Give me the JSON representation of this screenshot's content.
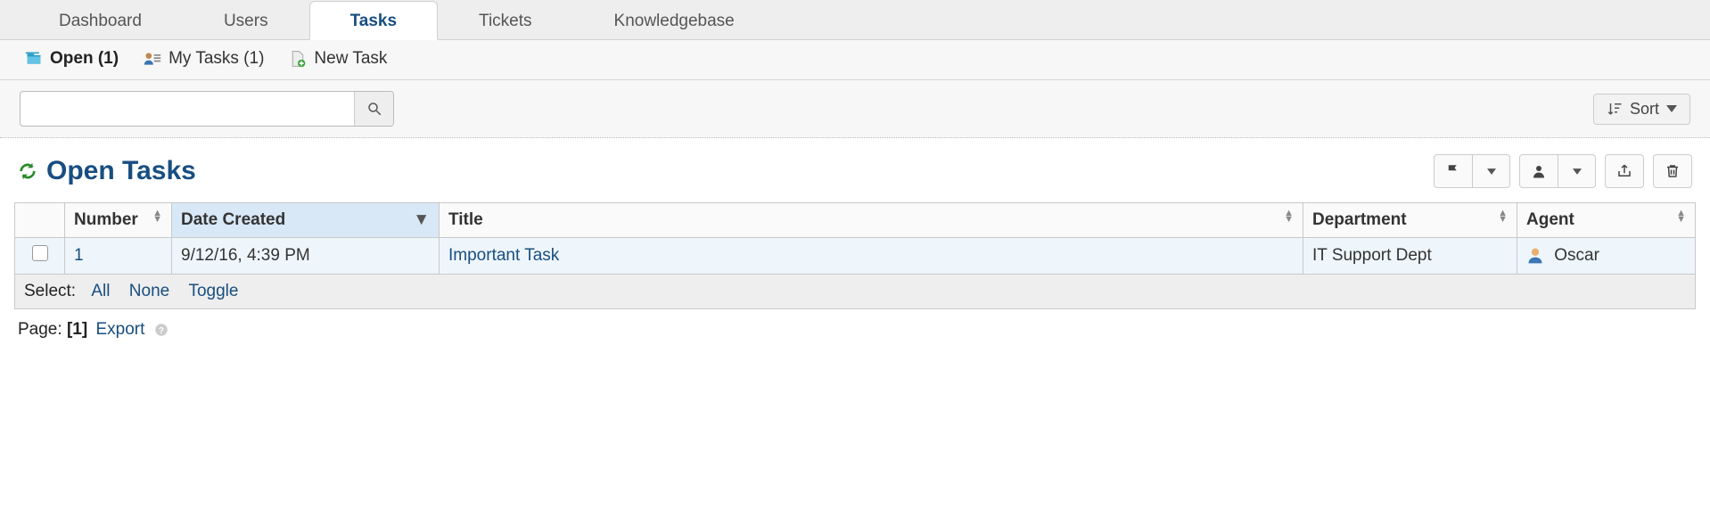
{
  "tabs": {
    "dashboard": "Dashboard",
    "users": "Users",
    "tasks": "Tasks",
    "tickets": "Tickets",
    "kb": "Knowledgebase"
  },
  "subnav": {
    "open": "Open (1)",
    "mytasks": "My Tasks (1)",
    "newtask": "New Task"
  },
  "search": {
    "value": ""
  },
  "sort_label": "Sort",
  "page_title": "Open Tasks",
  "columns": {
    "number": "Number",
    "date": "Date Created",
    "title": "Title",
    "dept": "Department",
    "agent": "Agent"
  },
  "rows": [
    {
      "number": "1",
      "date": "9/12/16, 4:39 PM",
      "title": "Important Task",
      "dept": "IT Support Dept",
      "agent": "Oscar"
    }
  ],
  "select": {
    "label": "Select:",
    "all": "All",
    "none": "None",
    "toggle": "Toggle"
  },
  "pager": {
    "label": "Page:",
    "current": "1",
    "export": "Export"
  }
}
